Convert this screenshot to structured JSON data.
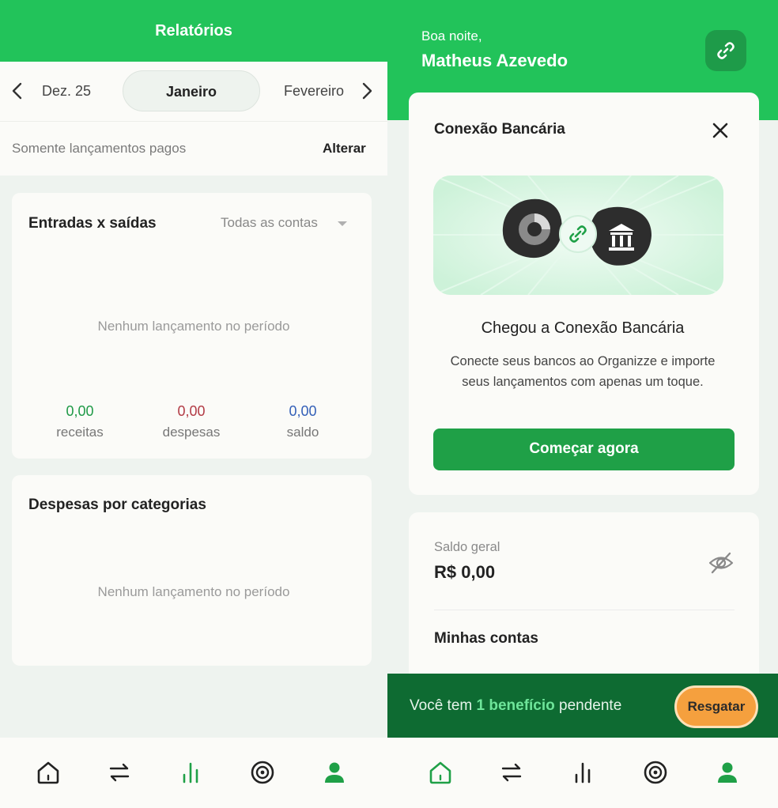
{
  "reports": {
    "title": "Relatórios",
    "month_prev": "Dez. 25",
    "month_current": "Janeiro",
    "month_next": "Fevereiro",
    "filter_text": "Somente lançamentos pagos",
    "filter_action": "Alterar",
    "income_card": {
      "title": "Entradas x saídas",
      "account_filter": "Todas as contas",
      "empty_message": "Nenhum lançamento no período",
      "stats": [
        {
          "value": "0,00",
          "label": "receitas",
          "color": "#1f9a47"
        },
        {
          "value": "0,00",
          "label": "despesas",
          "color": "#b23b45"
        },
        {
          "value": "0,00",
          "label": "saldo",
          "color": "#3460b8"
        }
      ]
    },
    "category_card": {
      "title": "Despesas por categorias",
      "empty_message": "Nenhum lançamento no período"
    }
  },
  "home": {
    "greeting": "Boa noite,",
    "user_name": "Matheus Azevedo",
    "connection_card": {
      "title": "Conexão Bancária",
      "headline": "Chegou a Conexão Bancária",
      "body": "Conecte seus bancos ao Organizze e importe seus lançamentos com apenas um toque.",
      "cta": "Começar agora"
    },
    "balance": {
      "label": "Saldo geral",
      "value": "R$ 0,00"
    },
    "accounts_title": "Minhas contas",
    "benefit": {
      "prefix": "Você tem ",
      "highlight": "1 benefício",
      "suffix": " pendente",
      "action": "Resgatar"
    }
  },
  "nav": {
    "items": [
      "home-icon",
      "transactions-icon",
      "reports-icon",
      "goals-icon",
      "profile-icon"
    ],
    "active_left": "reports-icon",
    "active_right": "home-icon"
  },
  "colors": {
    "brand_green": "#22c35a",
    "dark_green": "#0e6b32",
    "button_green": "#1fa047",
    "accent_orange": "#f5a03e"
  }
}
